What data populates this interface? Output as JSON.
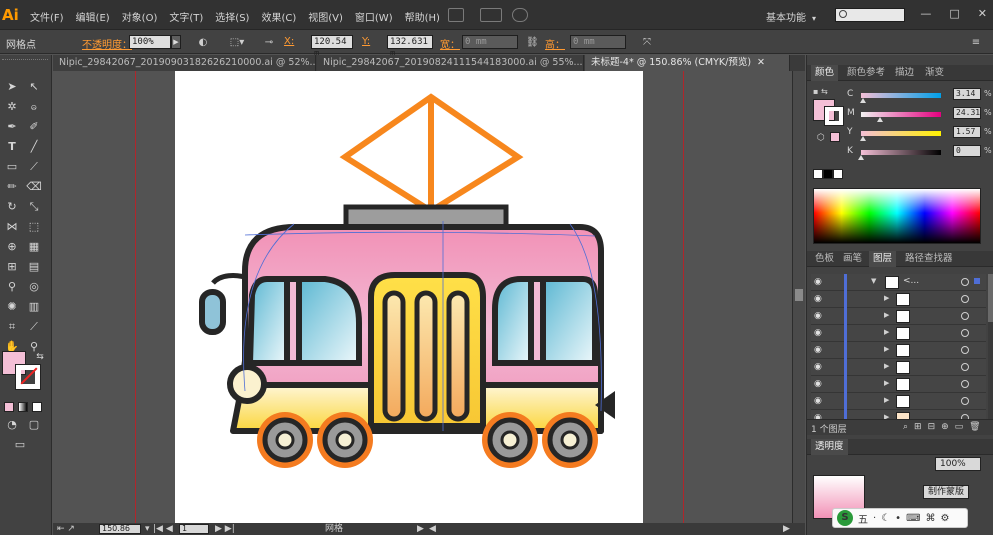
{
  "app": {
    "logo": "Ai",
    "menu": [
      "文件(F)",
      "编辑(E)",
      "对象(O)",
      "文字(T)",
      "选择(S)",
      "效果(C)",
      "视图(V)",
      "窗口(W)",
      "帮助(H)"
    ],
    "workspace_label": "基本功能",
    "search_placeholder": "",
    "window_buttons": [
      "—",
      "□",
      "✕"
    ]
  },
  "controlbar": {
    "object_type": "网格点",
    "opacity_label": "不透明度：",
    "opacity_value": "100%",
    "x_label": "X:",
    "x_value": "120.54 m",
    "y_label": "Y:",
    "y_value": "132.631 m",
    "w_label": "宽：",
    "w_value": "0 mm",
    "h_label": "高：",
    "h_value": "0 mm"
  },
  "tabs": [
    {
      "label": "Nipic_29842067_20190903182626210000.ai @ 52%...",
      "close": "✕"
    },
    {
      "label": "Nipic_29842067_20190824111544183000.ai @ 55%...",
      "close": "✕"
    },
    {
      "label": "未标题-4* @ 150.86% (CMYK/预览)",
      "close": "✕"
    }
  ],
  "status": {
    "zoom": "150.86",
    "artboard": "1",
    "tool_name": "网格"
  },
  "color_panel": {
    "tabs": [
      "颜色",
      "颜色参考",
      "描边",
      "渐变"
    ],
    "channels": [
      {
        "name": "C",
        "value": "3.14",
        "unit": "%",
        "level": 0.03,
        "gradient": "linear-gradient(to right,#f4bfd6,#00a0e9)"
      },
      {
        "name": "M",
        "value": "24.31",
        "unit": "%",
        "level": 0.24,
        "gradient": "linear-gradient(to right,#f0f0f0,#e4007f)"
      },
      {
        "name": "Y",
        "value": "1.57",
        "unit": "%",
        "level": 0.02,
        "gradient": "linear-gradient(to right,#f4bfd6,#fff100)"
      },
      {
        "name": "K",
        "value": "0",
        "unit": "%",
        "level": 0.0,
        "gradient": "linear-gradient(to right,#f4bfd6,#000000)"
      }
    ],
    "fill_color": "#f4bfd6"
  },
  "layers_panel": {
    "tabs": [
      "色板",
      "画笔",
      "图层",
      "路径查找器"
    ],
    "top_layer_name": "<...",
    "row_count": 9,
    "footer_label": "1 个图层"
  },
  "lower_panel": {
    "label": "透明度",
    "opacity_value": "100%",
    "button_label": "制作蒙版"
  },
  "ime": {
    "logo": "S",
    "chars": [
      "五",
      "·",
      "☾",
      "•",
      "⌨",
      "⌘",
      "⚙"
    ]
  }
}
